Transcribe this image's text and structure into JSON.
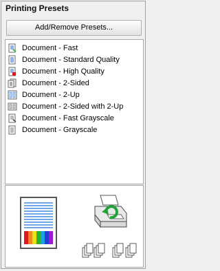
{
  "panel": {
    "title": "Printing Presets",
    "add_remove_label": "Add/Remove Presets..."
  },
  "presets": [
    {
      "label": "Document - Fast",
      "icon": "document-fast-icon"
    },
    {
      "label": "Document - Standard Quality",
      "icon": "document-standard-icon"
    },
    {
      "label": "Document - High Quality",
      "icon": "document-high-quality-icon"
    },
    {
      "label": "Document - 2-Sided",
      "icon": "document-2-sided-icon"
    },
    {
      "label": "Document - 2-Up",
      "icon": "document-2-up-icon"
    },
    {
      "label": "Document - 2-Sided with 2-Up",
      "icon": "document-2-sided-2-up-icon"
    },
    {
      "label": "Document - Fast Grayscale",
      "icon": "document-fast-grayscale-icon"
    },
    {
      "label": "Document - Grayscale",
      "icon": "document-grayscale-icon"
    }
  ],
  "colors": {
    "accent_blue": "#1a6fd8",
    "border": "#a9a9a9"
  }
}
